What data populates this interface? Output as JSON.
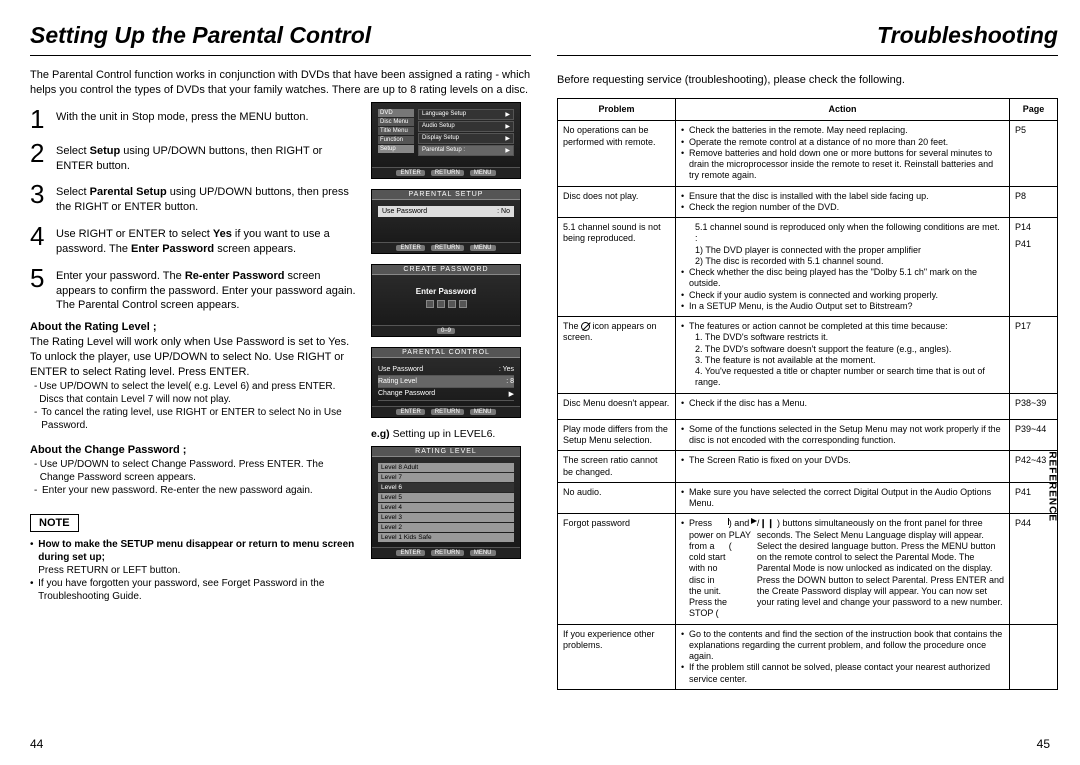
{
  "left": {
    "title": "Setting Up the Parental Control",
    "intro": "The Parental Control function works in conjunction with DVDs that have been assigned a rating - which helps you control the types of DVDs that your family watches. There are up to 8 rating levels on a disc.",
    "steps": [
      {
        "n": "1",
        "html": "With the unit in Stop mode, press the MENU button."
      },
      {
        "n": "2",
        "html": "Select <b>Setup</b> using UP/DOWN buttons, then RIGHT or ENTER button."
      },
      {
        "n": "3",
        "html": "Select <b>Parental Setup</b> using UP/DOWN buttons, then press the RIGHT or ENTER button."
      },
      {
        "n": "4",
        "html": "Use RIGHT or ENTER to select <b>Yes</b> if you want to use a password. The <b>Enter Password</b> screen appears."
      },
      {
        "n": "5",
        "html": "Enter your password. The <b>Re-enter Password</b> screen appears to confirm the password. Enter your password again. The Parental Control screen appears."
      }
    ],
    "ratingHead": "About the Rating Level ;",
    "ratingBody": "The Rating Level will work only when Use Password is set to Yes. To unlock the player, use UP/DOWN to select No. Use RIGHT or ENTER to select Rating level. Press ENTER.",
    "ratingBullets": [
      "Use UP/DOWN to select the level( e.g. Level 6) and press ENTER. Discs that contain Level 7 will now not play.",
      "To cancel the rating level, use RIGHT or ENTER to select No in Use Password."
    ],
    "changeHead": "About the Change Password ;",
    "changeBullets": [
      "Use UP/DOWN to select Change Password. Press ENTER. The Change Password screen appears.",
      "Enter your new password. Re-enter the new password again."
    ],
    "noteLabel": "NOTE",
    "noteItems": [
      {
        "bold": "How to make the SETUP menu disappear or return to menu screen during set up;",
        "rest": " Press RETURN or LEFT button."
      },
      {
        "bold": "",
        "rest": "If you have forgotten your password, see Forget Password in the Troubleshooting Guide."
      }
    ],
    "figCaption": "e.g) Setting up in LEVEL6.",
    "fig1": {
      "dvd": "DVD",
      "sideL": [
        "Disc Menu",
        "Title Menu",
        "Function",
        "Setup"
      ],
      "sideR": [
        {
          "l": "Language Setup",
          "r": "▶"
        },
        {
          "l": "Audio Setup",
          "r": "▶"
        },
        {
          "l": "Display Setup",
          "r": "▶"
        },
        {
          "l": "Parental Setup :",
          "r": "▶"
        }
      ],
      "bar": [
        "ENTER",
        "RETURN",
        "MENU"
      ]
    },
    "fig2": {
      "header": "PARENTAL SETUP",
      "line": {
        "l": "Use Password",
        "r": ": No"
      },
      "bar": [
        "ENTER",
        "RETURN",
        "MENU"
      ]
    },
    "fig3": {
      "header": "CREATE PASSWORD",
      "label": "Enter Password"
    },
    "fig4": {
      "header": "PARENTAL CONTROL",
      "lines": [
        {
          "l": "Use Password",
          "r": ": Yes"
        },
        {
          "l": "Rating Level",
          "r": ": 8"
        },
        {
          "l": "Change Password",
          "r": "▶"
        }
      ],
      "bar": [
        "ENTER",
        "RETURN",
        "MENU"
      ]
    },
    "fig5": {
      "header": "RATING LEVEL",
      "levels": [
        "Level 8 Adult",
        "Level 7",
        "Level 6",
        "Level 5",
        "Level 4",
        "Level 3",
        "Level 2",
        "Level 1 Kids Safe"
      ],
      "bar": [
        "ENTER",
        "RETURN",
        "MENU"
      ]
    },
    "pagenum": "44"
  },
  "right": {
    "title": "Troubleshooting",
    "intro": "Before requesting service (troubleshooting), please check the following.",
    "headers": {
      "problem": "Problem",
      "action": "Action",
      "page": "Page"
    },
    "rows": [
      {
        "problem": "No operations can be performed with remote.",
        "action": [
          "Check the batteries in the remote. May need replacing.",
          "Operate the remote control at a distance of no more than 20 feet.",
          "Remove batteries and hold down one or more buttons for several minutes to drain the microprocessor inside the remote to reset it. Reinstall batteries and try remote again."
        ],
        "pages": [
          "P5"
        ]
      },
      {
        "problem": "Disc does not play.",
        "action": [
          "Ensure that the disc is installed with the label side facing up.",
          "Check the region number of the DVD."
        ],
        "pages": [
          "P8"
        ]
      },
      {
        "problem": "5.1 channel sound is not being reproduced.",
        "action": [
          "5.1 channel sound is reproduced only when the following conditions are met. :",
          "1) The DVD player is connected with the proper amplifier",
          "2) The disc is recorded with 5.1 channel sound.",
          "Check whether the disc being played has the \"Dolby 5.1 ch\" mark on the outside.",
          "Check if your audio system is connected and working properly.",
          "In a SETUP Menu, is the Audio Output set to Bitstream?"
        ],
        "pages": [
          "P14",
          "P41"
        ]
      },
      {
        "problem": "The ⊘ icon appears on screen.",
        "action": [
          "The features or action cannot be completed at this time because:",
          "1. The DVD's software restricts it.",
          "2. The DVD's software doesn't support the feature (e.g., angles).",
          "3. The feature is not available at the moment.",
          "4. You've requested a title or chapter number or search time that is out of range."
        ],
        "pages": [
          "P17"
        ]
      },
      {
        "problem": "Disc Menu doesn't appear.",
        "action": [
          "Check if the disc has a Menu."
        ],
        "pages": [
          "P38~39"
        ]
      },
      {
        "problem": "Play mode differs from the Setup Menu selection.",
        "action": [
          "Some of the functions selected in the Setup Menu may not work properly if the disc is not encoded with the corresponding function."
        ],
        "pages": [
          "P39~44"
        ]
      },
      {
        "problem": "The screen ratio cannot be changed.",
        "action": [
          "The Screen Ratio is fixed on your DVDs."
        ],
        "pages": [
          "P42~43"
        ]
      },
      {
        "problem": "No audio.",
        "action": [
          "Make sure you have selected the correct Digital Output in the Audio Options Menu."
        ],
        "pages": [
          "P41"
        ]
      },
      {
        "problem": "Forgot password",
        "action": [
          "Press power on from a cold start with no disc in the unit. Press the STOP ( ■ ) and PLAY ( ▶/❙❙ ) buttons simultaneously on the front panel for three seconds. The Select Menu Language display will appear. Select the desired language button. Press the MENU button on the remote control to select the Parental Mode. The Parental Mode is now unlocked as indicated on the display. Press the DOWN button to select Parental. Press ENTER and the Create Password display will appear. You can now set your rating level and change your password to a new number."
        ],
        "pages": [
          "P44"
        ]
      },
      {
        "problem": "If you experience other problems.",
        "action": [
          "Go to the contents and find the section of the instruction book that contains the explanations regarding the current problem, and follow the procedure once again.",
          "If the problem still cannot be solved, please contact your nearest authorized service center."
        ],
        "pages": []
      }
    ],
    "sideTab": "REFERENCE",
    "pagenum": "45"
  }
}
